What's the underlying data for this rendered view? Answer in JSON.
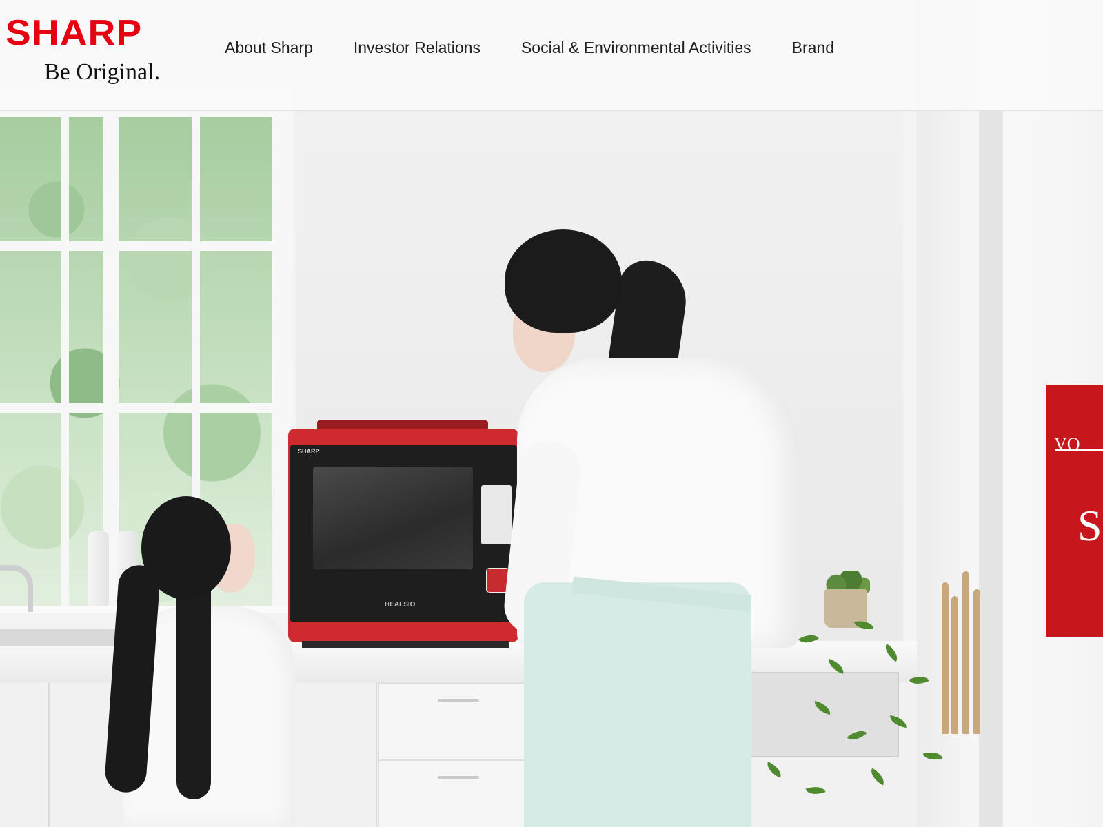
{
  "header": {
    "logo": {
      "wordmark": "SHARP",
      "tagline": "Be Original."
    },
    "nav": [
      {
        "label": "About Sharp"
      },
      {
        "label": "Investor Relations"
      },
      {
        "label": "Social & Environmental Activities"
      },
      {
        "label": "Brand"
      }
    ]
  },
  "hero": {
    "microwave": {
      "brand": "SHARP",
      "model": "HEALSIO"
    }
  },
  "side_banner": {
    "text": "VO",
    "glyph": "S"
  },
  "colors": {
    "brand_red": "#e60012",
    "banner_red": "#c8161d",
    "nav_text": "#222222"
  }
}
